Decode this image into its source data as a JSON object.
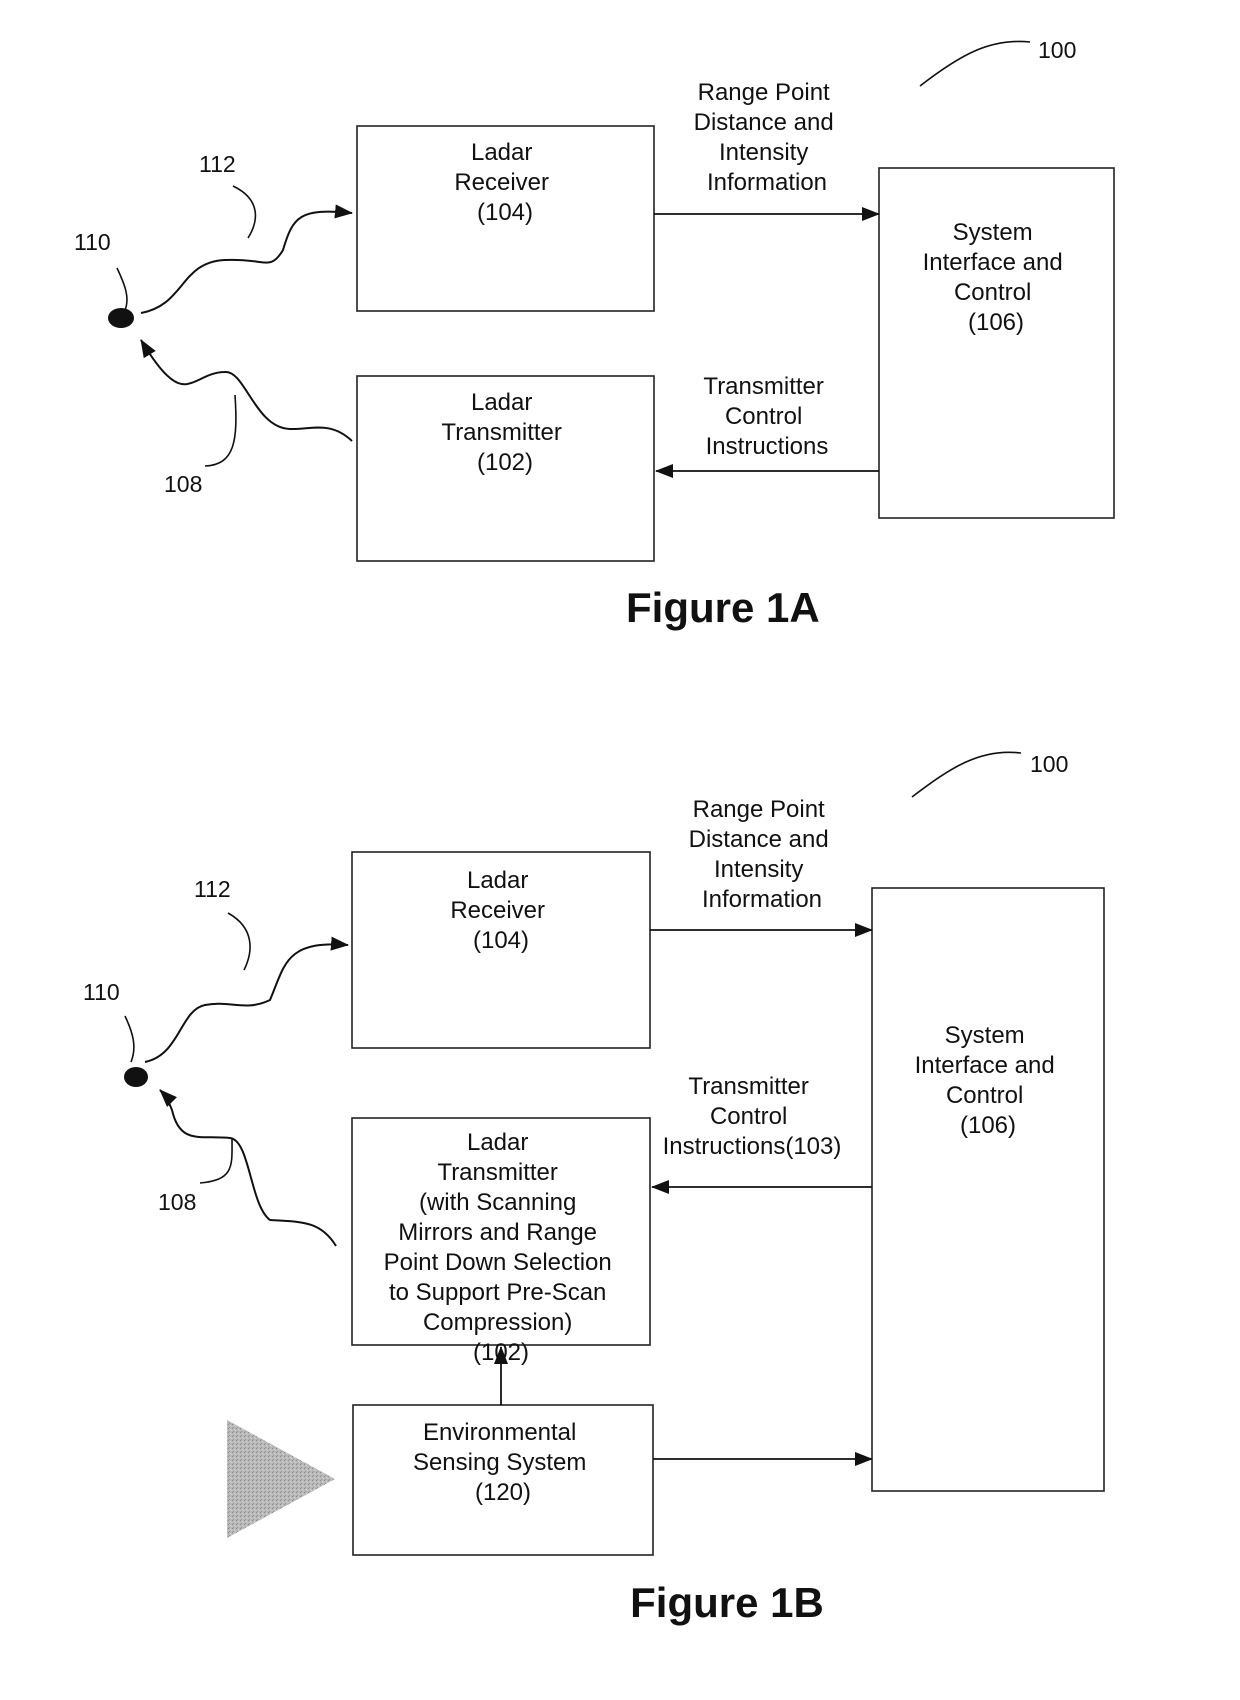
{
  "figure_1a": {
    "caption": "Figure 1A",
    "system_ref": "100",
    "target_ref": "110",
    "return_ref": "112",
    "beam_ref": "108",
    "receiver": [
      "Ladar",
      "Receiver",
      "(104)"
    ],
    "transmitter": [
      "Ladar",
      "Transmitter",
      "(102)"
    ],
    "system": [
      "System",
      "Interface and",
      "Control",
      "(106)"
    ],
    "range_label": [
      "Range Point",
      "Distance and",
      "Intensity",
      "Information"
    ],
    "control_label": [
      "Transmitter",
      "Control",
      "Instructions"
    ]
  },
  "figure_1b": {
    "caption": "Figure 1B",
    "system_ref": "100",
    "target_ref": "110",
    "return_ref": "112",
    "beam_ref": "108",
    "receiver": [
      "Ladar",
      "Receiver",
      "(104)"
    ],
    "transmitter": [
      "Ladar",
      "Transmitter",
      "(with Scanning",
      "Mirrors and Range",
      "Point Down Selection",
      "to Support Pre-Scan",
      "Compression)",
      "(102)"
    ],
    "system": [
      "System",
      "Interface and",
      "Control",
      "(106)"
    ],
    "range_label": [
      "Range Point",
      "Distance and",
      "Intensity",
      "Information"
    ],
    "control_label": [
      "Transmitter",
      "Control",
      "Instructions(103)"
    ],
    "env": [
      "Environmental",
      "Sensing System",
      "(120)"
    ]
  }
}
